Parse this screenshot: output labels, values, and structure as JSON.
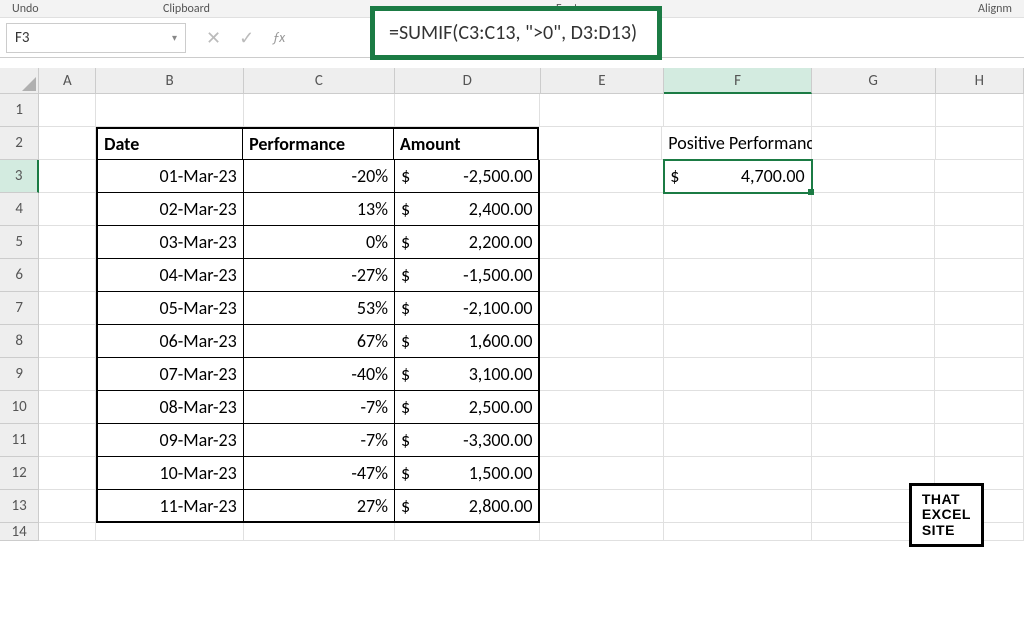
{
  "ribbon": {
    "undo": "Undo",
    "clipboard": "Clipboard",
    "font": "Font",
    "alignment": "Alignm"
  },
  "namebox": {
    "value": "F3"
  },
  "formula": "=SUMIF(C3:C13, \">0\", D3:D13)",
  "cols": [
    "A",
    "B",
    "C",
    "D",
    "E",
    "F",
    "G",
    "H"
  ],
  "active_col": "F",
  "active_row": "3",
  "table_headers": {
    "b": "Date",
    "c": "Performance",
    "d": "Amount"
  },
  "f2_label": "Positive Performance Only",
  "f3": {
    "sym": "$",
    "val": "4,700.00"
  },
  "rows": [
    {
      "n": "3",
      "date": "01-Mar-23",
      "perf": "-20%",
      "sym": "$",
      "amt": "-2,500.00"
    },
    {
      "n": "4",
      "date": "02-Mar-23",
      "perf": "13%",
      "sym": "$",
      "amt": "2,400.00"
    },
    {
      "n": "5",
      "date": "03-Mar-23",
      "perf": "0%",
      "sym": "$",
      "amt": "2,200.00"
    },
    {
      "n": "6",
      "date": "04-Mar-23",
      "perf": "-27%",
      "sym": "$",
      "amt": "-1,500.00"
    },
    {
      "n": "7",
      "date": "05-Mar-23",
      "perf": "53%",
      "sym": "$",
      "amt": "-2,100.00"
    },
    {
      "n": "8",
      "date": "06-Mar-23",
      "perf": "67%",
      "sym": "$",
      "amt": "1,600.00"
    },
    {
      "n": "9",
      "date": "07-Mar-23",
      "perf": "-40%",
      "sym": "$",
      "amt": "3,100.00"
    },
    {
      "n": "10",
      "date": "08-Mar-23",
      "perf": "-7%",
      "sym": "$",
      "amt": "2,500.00"
    },
    {
      "n": "11",
      "date": "09-Mar-23",
      "perf": "-7%",
      "sym": "$",
      "amt": "-3,300.00"
    },
    {
      "n": "12",
      "date": "10-Mar-23",
      "perf": "-47%",
      "sym": "$",
      "amt": "1,500.00"
    },
    {
      "n": "13",
      "date": "11-Mar-23",
      "perf": "27%",
      "sym": "$",
      "amt": "2,800.00"
    }
  ],
  "watermark": {
    "l1": "THAT",
    "l2": "EXCEL",
    "l3": "SITE"
  }
}
